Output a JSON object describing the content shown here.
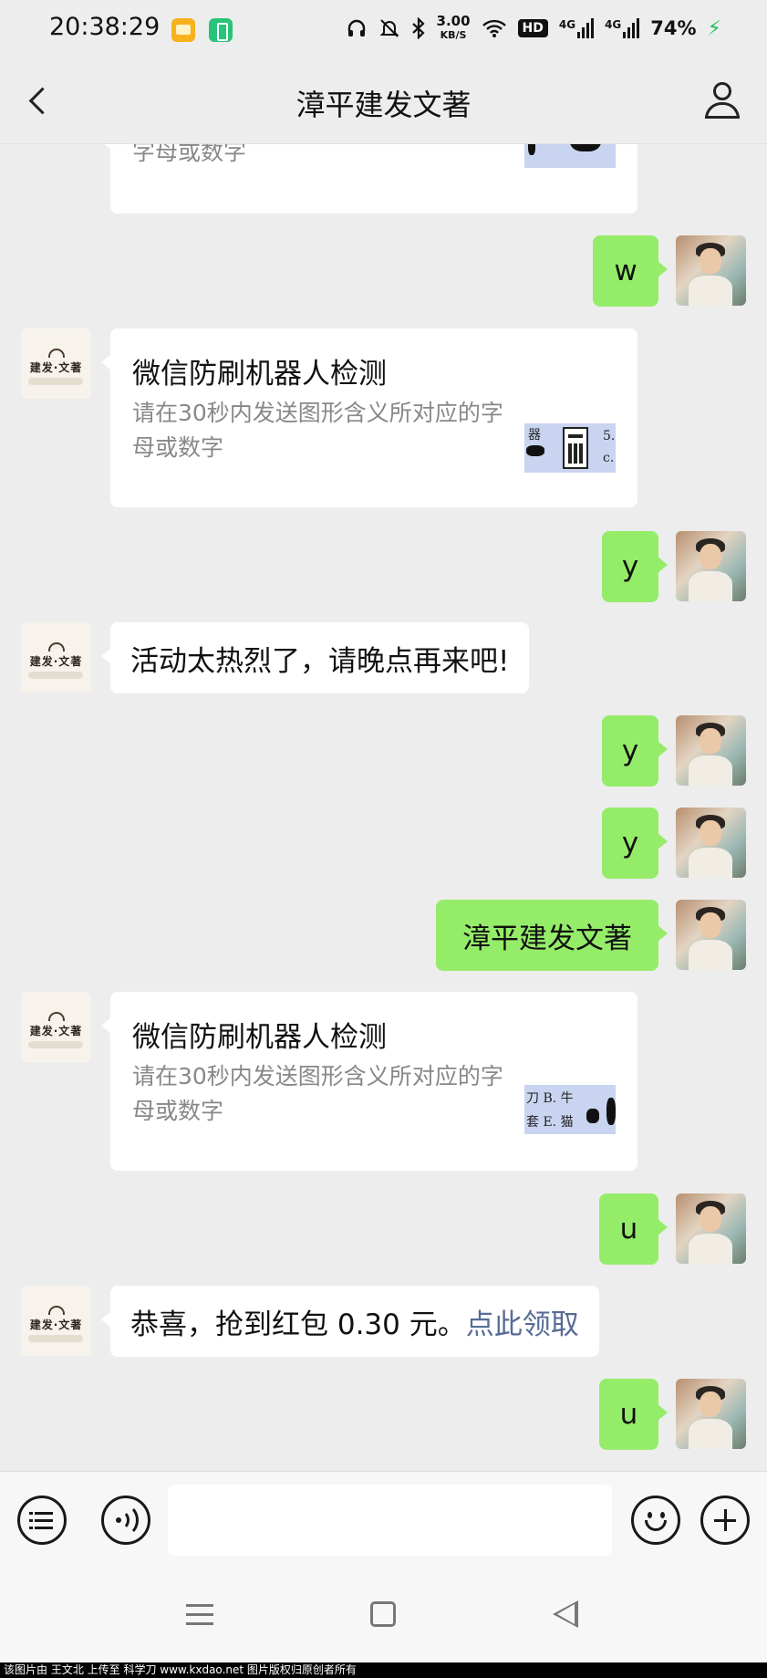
{
  "status_bar": {
    "time": "20:38:29",
    "net_speed_value": "3.00",
    "net_speed_unit": "KB/S",
    "hd_label": "HD",
    "signal1_label": "4G",
    "signal2_label": "4G",
    "battery": "74%",
    "icons": [
      "mail-notification-icon",
      "battery-app-icon",
      "headphones-icon",
      "mute-bell-icon",
      "bluetooth-icon",
      "wifi-icon",
      "charging-icon"
    ]
  },
  "header": {
    "title": "漳平建发文著",
    "back_icon": "chevron-left-icon",
    "profile_icon": "person-icon"
  },
  "bot_avatar_text": "建发·文著",
  "messages": {
    "m0": {
      "side": "left",
      "type": "card",
      "desc_tail": "字母或数字"
    },
    "m1": {
      "side": "right",
      "text": "w"
    },
    "m2": {
      "side": "left",
      "type": "card",
      "title": "微信防刷机器人检测",
      "desc": "请在30秒内发送图形含义所对应的字母或数字"
    },
    "m3": {
      "side": "right",
      "text": "y"
    },
    "m4": {
      "side": "left",
      "text": "活动太热烈了，请晚点再来吧!"
    },
    "m5": {
      "side": "right",
      "text": "y"
    },
    "m6": {
      "side": "right",
      "text": "y"
    },
    "m7": {
      "side": "right",
      "text": "漳平建发文著"
    },
    "m8": {
      "side": "left",
      "type": "card",
      "title": "微信防刷机器人检测",
      "desc": "请在30秒内发送图形含义所对应的字母或数字"
    },
    "m9": {
      "side": "right",
      "text": "u"
    },
    "m10": {
      "side": "left",
      "text": "恭喜，抢到红包 0.30 元。",
      "link": "点此领取"
    },
    "m11": {
      "side": "right",
      "text": "u"
    }
  },
  "captcha_glyphs": {
    "card2_a": "5.",
    "card2_b": "c.",
    "card2_c": "器",
    "card8_a": "刀 B. 牛",
    "card8_b": "套 E. 猫"
  },
  "input_bar": {
    "value": "",
    "icons": [
      "menu-list-icon",
      "voice-icon",
      "emoji-icon",
      "plus-icon"
    ]
  },
  "system_nav": {
    "icons": [
      "menu-nav-icon",
      "home-nav-icon",
      "back-nav-icon"
    ]
  },
  "watermark": "该图片由 王文北 上传至 科学刀 www.kxdao.net 图片版权归原创者所有"
}
